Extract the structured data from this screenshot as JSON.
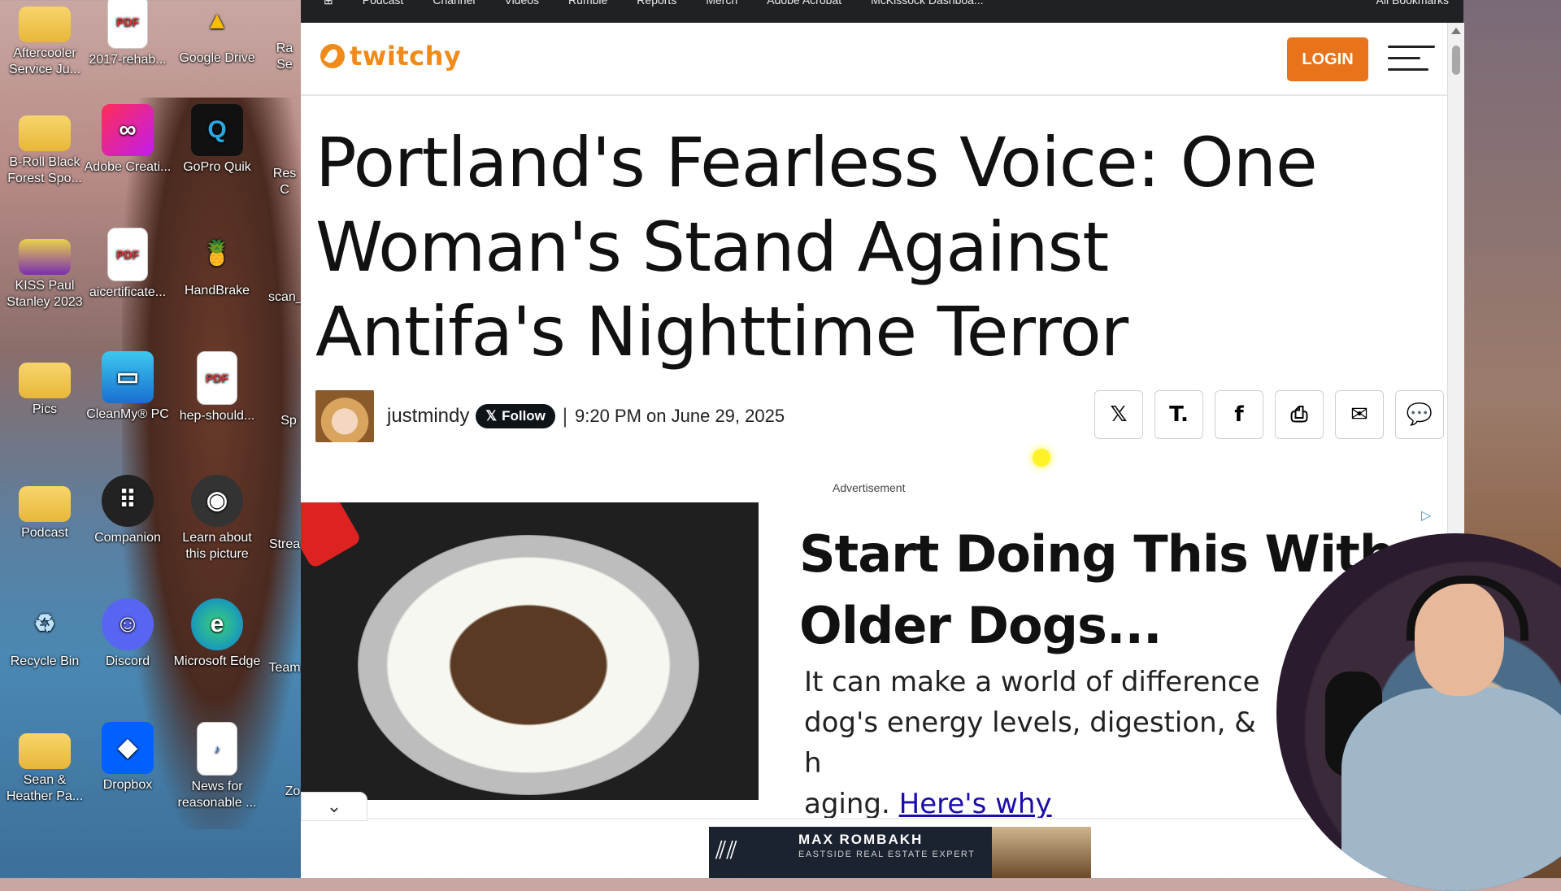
{
  "desktop": {
    "icons": [
      {
        "label": "Aftercooler Service Ju...",
        "icon": "folder-icon"
      },
      {
        "label": "2017-rehab...",
        "icon": "pdf-icon"
      },
      {
        "label": "Google Drive",
        "icon": "google-drive-icon"
      },
      {
        "label": "B-Roll Black Forest Spo...",
        "icon": "folder-icon"
      },
      {
        "label": "Adobe Creati...",
        "icon": "adobe-cc-icon"
      },
      {
        "label": "GoPro Quik",
        "icon": "gopro-quik-icon"
      },
      {
        "label": "KISS Paul Stanley 2023",
        "icon": "folder-icon"
      },
      {
        "label": "aicertificate...",
        "icon": "pdf-icon"
      },
      {
        "label": "HandBrake",
        "icon": "handbrake-icon"
      },
      {
        "label": "Pics",
        "icon": "folder-icon"
      },
      {
        "label": "CleanMy® PC",
        "icon": "cleanmypc-icon"
      },
      {
        "label": "hep-should...",
        "icon": "pdf-icon"
      },
      {
        "label": "Podcast",
        "icon": "folder-icon"
      },
      {
        "label": "Companion",
        "icon": "companion-icon"
      },
      {
        "label": "Learn about this picture",
        "icon": "camera-icon"
      },
      {
        "label": "Recycle Bin",
        "icon": "recycle-bin-icon"
      },
      {
        "label": "Discord",
        "icon": "discord-icon"
      },
      {
        "label": "Microsoft Edge",
        "icon": "edge-icon"
      },
      {
        "label": "Sean & Heather Pa...",
        "icon": "folder-icon"
      },
      {
        "label": "Dropbox",
        "icon": "dropbox-icon"
      },
      {
        "label": "News for reasonable ...",
        "icon": "mp3-icon"
      }
    ],
    "partial_labels": [
      "Ra Se",
      "Res C",
      "scan_",
      "Sp",
      "Strea",
      "Team",
      "Zo"
    ]
  },
  "browser": {
    "bookmarks": [
      "Podcast",
      "Channel",
      "Videos",
      "Rumble",
      "Reports",
      "Merch",
      "Adobe Acrobat",
      "McKissock Dashboa...",
      "All Bookmarks"
    ]
  },
  "site": {
    "logo_text": "twitchy",
    "login_label": "LOGIN",
    "accent_color": "#e8731b"
  },
  "article": {
    "headline": "Portland's Fearless Voice: One Woman's Stand Against Antifa's Nighttime Terror",
    "author": "justmindy",
    "follow_label": "Follow",
    "separator": "|",
    "datetime": "9:20 PM on June 29, 2025",
    "share_buttons": [
      {
        "name": "x-share",
        "icon": "x-icon",
        "glyph": "𝕏"
      },
      {
        "name": "truth-social-share",
        "icon": "truth-social-icon",
        "glyph": "T."
      },
      {
        "name": "facebook-share",
        "icon": "facebook-icon",
        "glyph": "f"
      },
      {
        "name": "print-share",
        "icon": "print-icon",
        "glyph": "⎙"
      },
      {
        "name": "email-share",
        "icon": "envelope-icon",
        "glyph": "✉"
      },
      {
        "name": "comments",
        "icon": "comment-icon",
        "glyph": "💬"
      }
    ]
  },
  "advertisement": {
    "label": "Advertisement",
    "title": "Start Doing This With Older Dogs...",
    "body": "It can make a world of difference to your dog's energy levels, digestion, & healthy aging.",
    "body_visible_a": "It can make a world of difference",
    "body_visible_b": "dog's energy levels, digestion, & h",
    "body_visible_c": "aging.",
    "link_text": "Here's why"
  },
  "banner_ad": {
    "name": "MAX ROMBAKH",
    "tagline": "EASTSIDE REAL ESTATE EXPERT"
  }
}
